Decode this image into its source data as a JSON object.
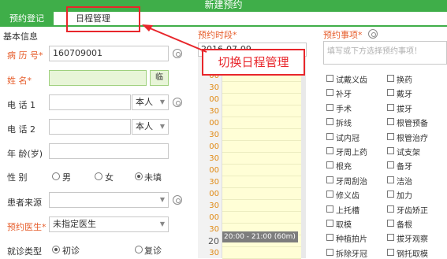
{
  "window": {
    "title": "新建预约"
  },
  "tabs": [
    {
      "label": "预约登记"
    },
    {
      "label": "日程管理"
    }
  ],
  "left": {
    "section_title": "基本信息",
    "case_no": {
      "label": "病 历 号*",
      "value": "160709001"
    },
    "name": {
      "label": "姓    名*",
      "value": "",
      "temp_button": "临"
    },
    "phone1": {
      "label": "电    话 1",
      "value": "",
      "relation": "本人"
    },
    "phone2": {
      "label": "电    话 2",
      "value": "",
      "relation": "本人"
    },
    "age": {
      "label": "年 龄(岁)",
      "value": ""
    },
    "gender": {
      "label": "性      别",
      "options": [
        "男",
        "女",
        "未填"
      ],
      "selected": "未填"
    },
    "source": {
      "label": "患者来源",
      "value": ""
    },
    "doctor": {
      "label": "预约医生*",
      "value": "未指定医生"
    },
    "visit_type": {
      "label": "就诊类型",
      "options": [
        "初诊",
        "复诊"
      ],
      "selected": "初诊"
    }
  },
  "schedule": {
    "label": "预约时段*",
    "date": "2016-07-09",
    "times": [
      {
        "label": "30",
        "hour": false
      },
      {
        "label": "00",
        "hour": false
      },
      {
        "label": "30",
        "hour": false
      },
      {
        "label": "00",
        "hour": false
      },
      {
        "label": "30",
        "hour": false
      },
      {
        "label": "00",
        "hour": false
      },
      {
        "label": "30",
        "hour": false
      },
      {
        "label": "00",
        "hour": false
      },
      {
        "label": "30",
        "hour": false
      },
      {
        "label": "00",
        "hour": false
      },
      {
        "label": "30",
        "hour": false
      },
      {
        "label": "00",
        "hour": false
      },
      {
        "label": "30",
        "hour": false
      },
      {
        "label": "00",
        "hour": false
      },
      {
        "label": "30",
        "hour": false
      },
      {
        "label": "20",
        "hour": true
      },
      {
        "label": "30",
        "hour": false
      }
    ],
    "booked_slot": "20:00 - 21:00 (60m)"
  },
  "callout": {
    "text": "切换日程管理"
  },
  "items": {
    "label": "预约事项*",
    "placeholder": "填写或下方选择预约事项！",
    "col1": [
      "试戴义齿",
      "补牙",
      "手术",
      "拆线",
      "试内冠",
      "牙周上药",
      "根充",
      "牙周刮治",
      "修义齿",
      "上托槽",
      "取模",
      "种植拍片",
      "拆除牙冠"
    ],
    "col2": [
      "换药",
      "戴牙",
      "拔牙",
      "根管预备",
      "根管治疗",
      "试支架",
      "备牙",
      "洁治",
      "加力",
      "牙齿矫正",
      "备根",
      "拔牙观察",
      "钢托取模"
    ]
  }
}
